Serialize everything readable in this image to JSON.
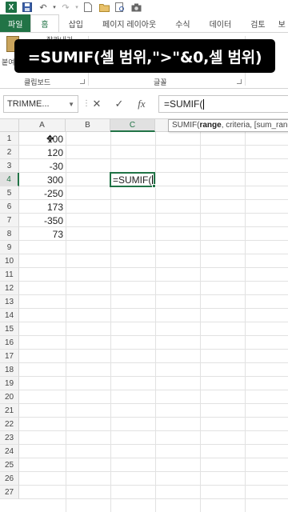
{
  "app": {
    "accent": "#217346",
    "logo_letter": "X"
  },
  "quick_access": {
    "icons": [
      "excel-logo",
      "save-icon",
      "undo-icon",
      "redo-icon",
      "new-file-icon",
      "open-folder-icon",
      "print-preview-icon",
      "camera-icon"
    ]
  },
  "tabs": [
    "파일",
    "홈",
    "삽입",
    "페이지 레이아웃",
    "수식",
    "데이터",
    "검토",
    "보"
  ],
  "ribbon": {
    "paste_label": "붙여",
    "cut_label": "잘라내기",
    "groups": {
      "clipboard": "클립보드",
      "font": "글꼴"
    }
  },
  "caption": "=SUMIF(셀 범위,\">\"&0,셀 범위)",
  "formula_bar": {
    "name_box": "TRIMME...",
    "cancel_symbol": "✕",
    "enter_symbol": "✓",
    "fx_symbol": "fx",
    "formula": "=SUMIF("
  },
  "tooltip": {
    "func": "SUMIF(",
    "bold_arg": "range",
    "rest": ", criteria, [sum_range])"
  },
  "grid": {
    "columns": [
      "A",
      "B",
      "C"
    ],
    "selected_column": "C",
    "rows": [
      "1",
      "2",
      "3",
      "4",
      "5",
      "6",
      "7",
      "8",
      "9",
      "10",
      "11",
      "12",
      "13",
      "14",
      "15",
      "16",
      "17",
      "18",
      "19",
      "20",
      "21",
      "22",
      "23",
      "24",
      "25",
      "26",
      "27"
    ],
    "selected_row": "4",
    "column_a_values": [
      "100",
      "120",
      "-30",
      "300",
      "-250",
      "173",
      "-350",
      "73"
    ],
    "active_cell_text": "=SUMIF("
  }
}
